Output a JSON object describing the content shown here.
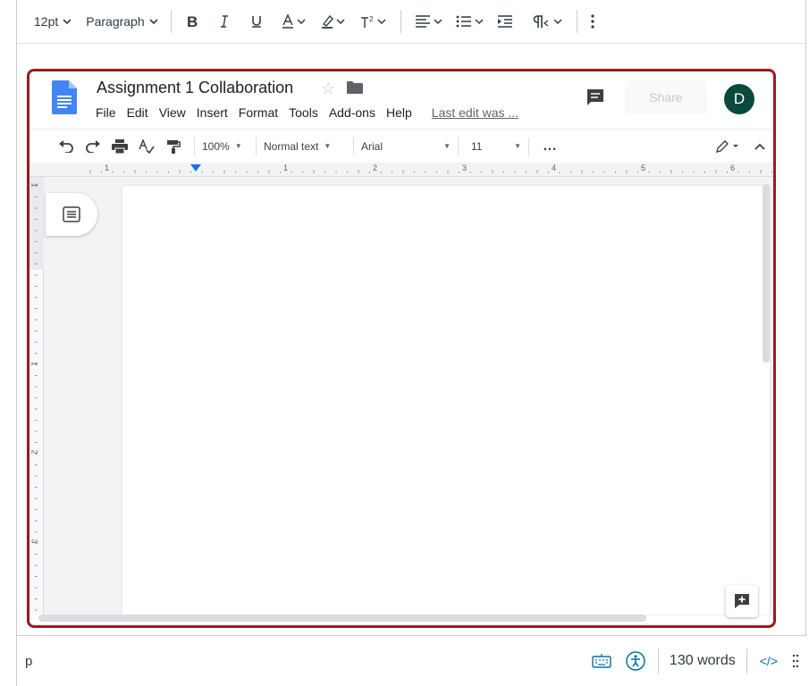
{
  "toolbar": {
    "font_size": "12pt",
    "block_format": "Paragraph"
  },
  "gdoc": {
    "title": "Assignment 1 Collaboration",
    "menu": [
      "File",
      "Edit",
      "View",
      "Insert",
      "Format",
      "Tools",
      "Add-ons",
      "Help"
    ],
    "last_edit": "Last edit was ...",
    "share_label": "Share",
    "avatar_initial": "D",
    "zoom": "100%",
    "style": "Normal text",
    "font": "Arial",
    "size": "11",
    "more": "…",
    "ruler_numbers": [
      "1",
      "1",
      "2",
      "3",
      "4",
      "5",
      "6"
    ],
    "vruler_numbers": [
      "1",
      "1",
      "2",
      "3"
    ]
  },
  "status": {
    "element_path": "p",
    "word_count": "130 words",
    "html_toggle": "</>"
  },
  "colors": {
    "frame_border": "#9b1b1e",
    "avatar_bg": "#0a4a3c",
    "docs_blue": "#4285f4",
    "link_blue": "#0770a3"
  }
}
